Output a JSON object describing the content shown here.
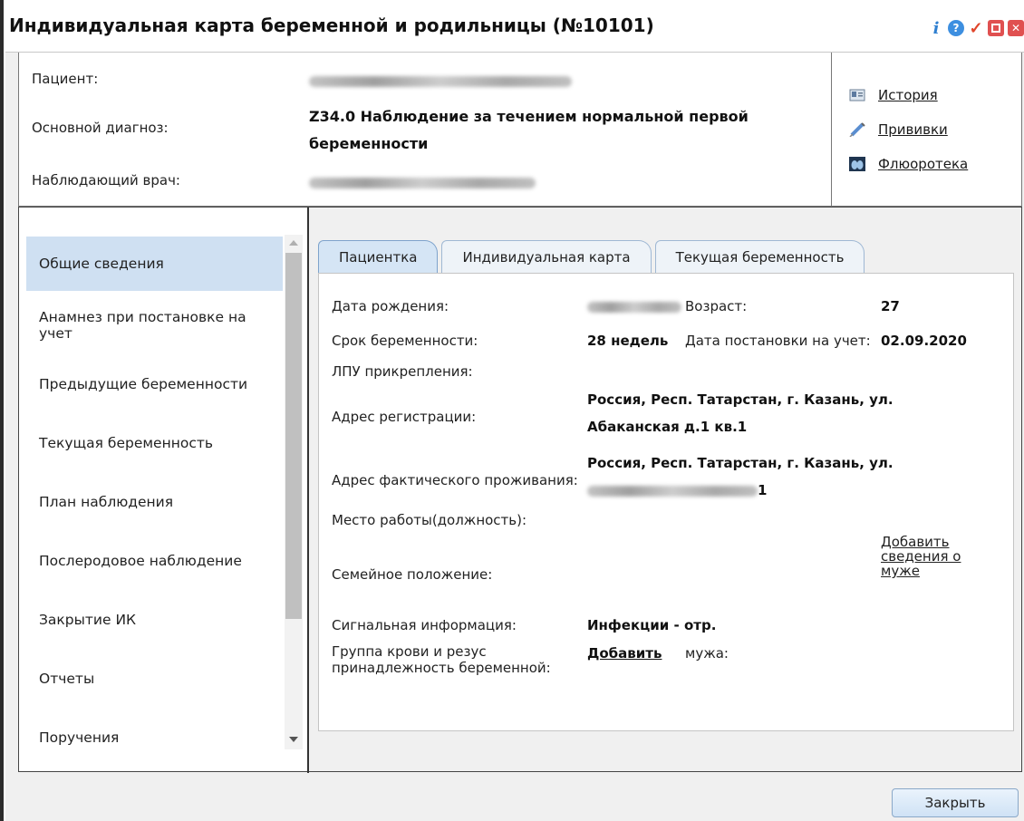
{
  "window": {
    "title": "Индивидуальная карта беременной и родильницы (№10101)",
    "icons": [
      "info-icon",
      "help-icon",
      "check-icon",
      "minimize-icon",
      "close-icon"
    ],
    "info_glyph": "i",
    "help_glyph": "?",
    "check_glyph": "✓",
    "close_glyph": "✕"
  },
  "header": {
    "patient_label": "Пациент:",
    "diagnosis_label": "Основной диагноз:",
    "diagnosis_value": "Z34.0 Наблюдение за течением нормальной первой беременности",
    "doctor_label": "Наблюдающий врач:",
    "links": [
      {
        "label": "История",
        "icon": "history-card-icon"
      },
      {
        "label": "Прививки",
        "icon": "syringe-icon"
      },
      {
        "label": "Флюоротека",
        "icon": "lungs-icon"
      }
    ]
  },
  "nav": {
    "items": [
      {
        "label": "Общие сведения",
        "active": true
      },
      {
        "label": "Анамнез при постановке на учет"
      },
      {
        "label": "Предыдущие беременности"
      },
      {
        "label": "Текущая беременность"
      },
      {
        "label": "План наблюдения"
      },
      {
        "label": "Послеродовое наблюдение"
      },
      {
        "label": "Закрытие ИК"
      },
      {
        "label": "Отчеты"
      },
      {
        "label": "Поручения"
      }
    ]
  },
  "tabs": [
    {
      "label": "Пациентка",
      "active": true
    },
    {
      "label": "Индивидуальная карта"
    },
    {
      "label": "Текущая беременность"
    }
  ],
  "patient_tab": {
    "birth_date_label": "Дата рождения:",
    "age_label": "Возраст:",
    "age_value": "27",
    "term_label": "Срок беременности:",
    "term_value": "28 недель",
    "reg_date_label": "Дата постановки на учет:",
    "reg_date_value": "02.09.2020",
    "lpu_label": "ЛПУ прикрепления:",
    "reg_address_label": "Адрес регистрации:",
    "reg_address_line1": "Россия, Респ. Татарстан, г. Казань, ул.",
    "reg_address_line2": "Абаканская д.1 кв.1",
    "actual_address_label": "Адрес фактического проживания:",
    "actual_address_line1": "Россия, Респ. Татарстан, г. Казань, ул.",
    "actual_address_tail": "1",
    "work_label": "Место работы(должность):",
    "family_label": "Семейное положение:",
    "add_husband_line1": "Добавить",
    "add_husband_line2": "сведения о",
    "add_husband_line3": "муже",
    "signal_label": "Сигнальная информация:",
    "signal_value": "Инфекции - отр.",
    "blood_label_line1": "Группа крови и резус",
    "blood_label_line2": "принадлежность беременной:",
    "blood_add_link": "Добавить",
    "husband_label": "мужа:"
  },
  "footer": {
    "close_label": "Закрыть"
  }
}
